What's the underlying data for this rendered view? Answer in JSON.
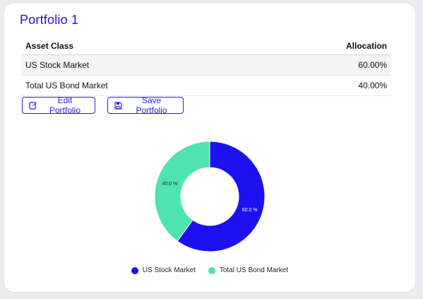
{
  "portfolio": {
    "title": "Portfolio 1"
  },
  "table": {
    "headers": {
      "asset_class": "Asset Class",
      "allocation": "Allocation"
    },
    "rows": [
      {
        "asset": "US Stock Market",
        "allocation": "60.00%"
      },
      {
        "asset": "Total US Bond Market",
        "allocation": "40.00%"
      }
    ]
  },
  "buttons": {
    "edit": {
      "label": "Edit Portfolio",
      "icon": "edit-icon"
    },
    "save": {
      "label": "Save Portfolio",
      "icon": "save-icon"
    }
  },
  "colors": {
    "accent": "#1f14e6",
    "stock": "#1d11f2",
    "bond": "#50e3b2"
  },
  "chart_data": {
    "type": "pie",
    "donut": true,
    "categories": [
      "US Stock Market",
      "Total US Bond Market"
    ],
    "values": [
      60.0,
      40.0
    ],
    "labels": [
      "60.0 %",
      "40.0 %"
    ],
    "colors": [
      "#1d11f2",
      "#50e3b2"
    ],
    "legend": "bottom"
  }
}
